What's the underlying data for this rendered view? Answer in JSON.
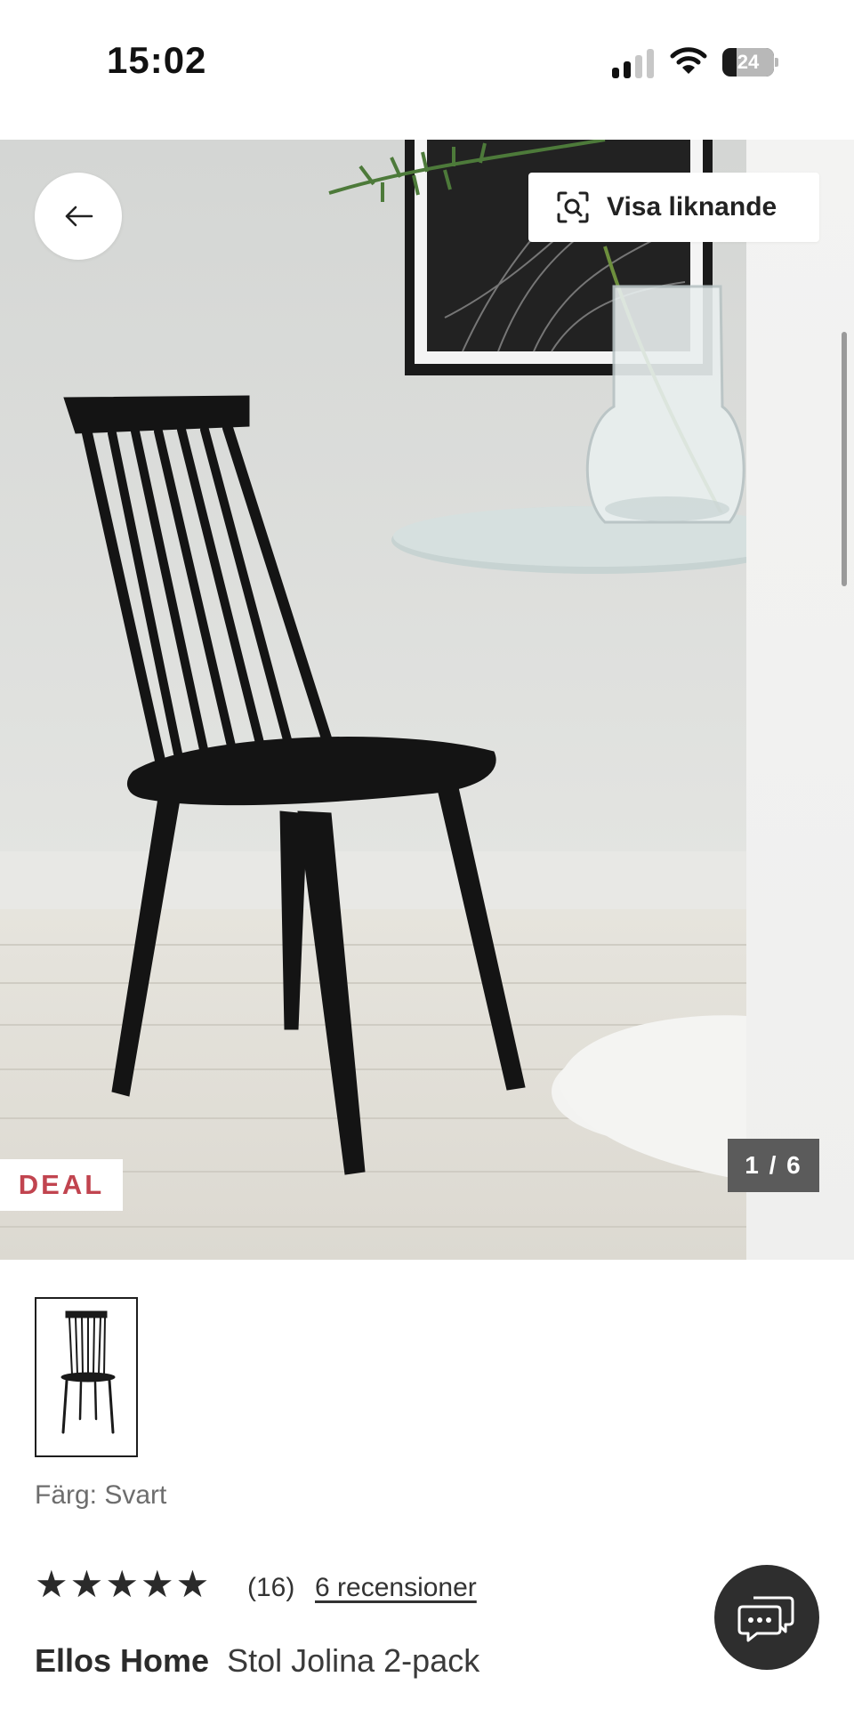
{
  "status_bar": {
    "time": "15:02",
    "battery_level": "24",
    "icons": [
      "signal-icon",
      "wifi-icon",
      "battery-icon"
    ]
  },
  "gallery": {
    "similar_button_label": "Visa liknande",
    "deal_badge": "DEAL",
    "page_counter": "1 / 6",
    "icons": [
      "back-arrow-icon",
      "visual-search-icon"
    ]
  },
  "product": {
    "color_label": "Färg: Svart",
    "rating_stars": 5,
    "rating_count": "(16)",
    "reviews_link": "6 recensioner",
    "brand": "Ellos Home",
    "name": "Stol Jolina 2-pack"
  },
  "colors": {
    "deal_red": "#c1444f",
    "chat_bg": "#2e2e2e",
    "counter_bg": "#5b5b5b"
  }
}
